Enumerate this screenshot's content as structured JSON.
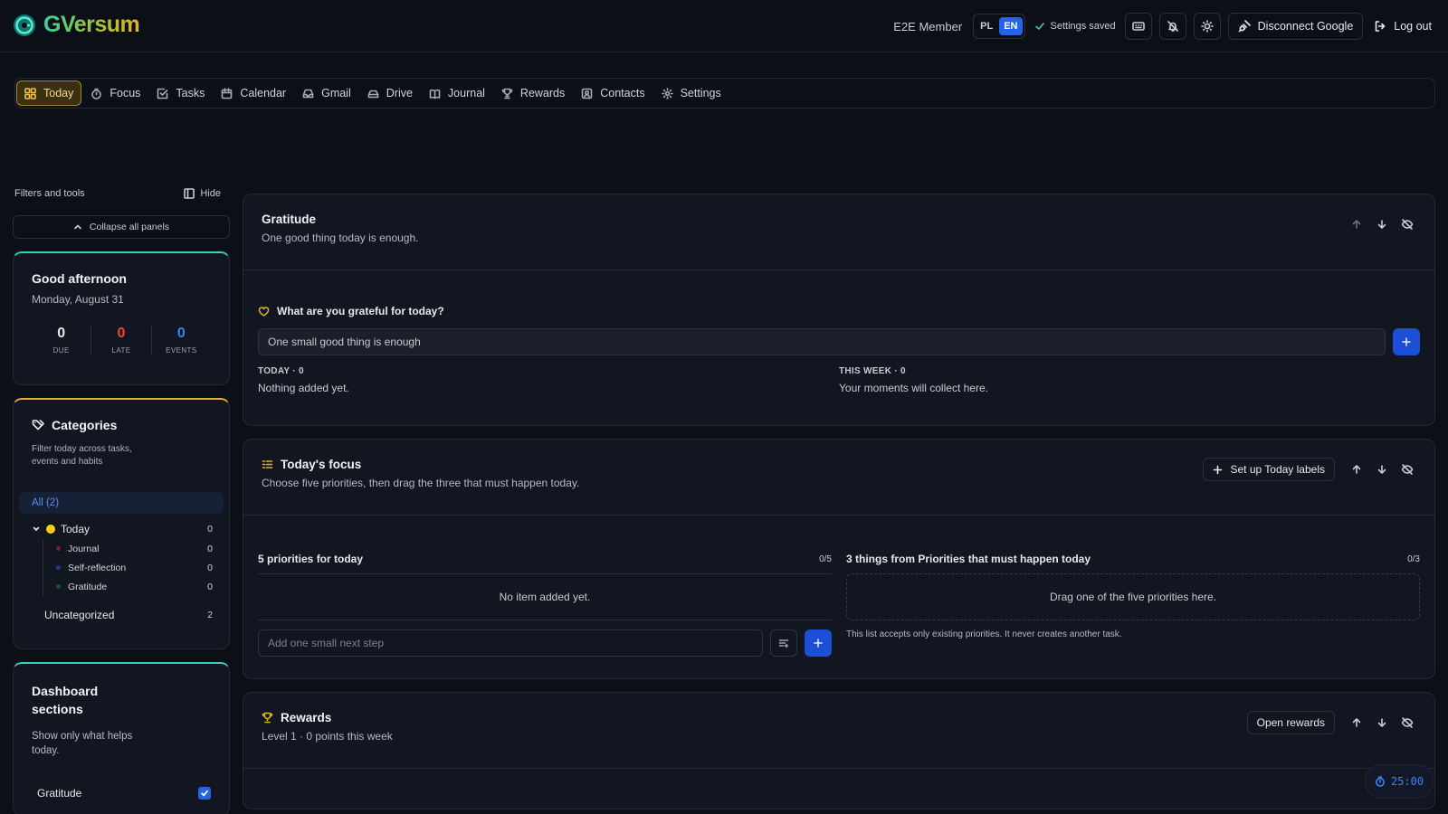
{
  "app": {
    "name": "GVersum"
  },
  "header": {
    "member_label": "E2E Member",
    "lang_options": [
      "PL",
      "EN"
    ],
    "lang_active": "EN",
    "saved_status": "Settings saved",
    "disconnect_label": "Disconnect Google",
    "logout_label": "Log out"
  },
  "nav": {
    "items": [
      {
        "label": "Today",
        "icon": "grid-icon",
        "active": true
      },
      {
        "label": "Focus",
        "icon": "timer-icon"
      },
      {
        "label": "Tasks",
        "icon": "checkbox-icon"
      },
      {
        "label": "Calendar",
        "icon": "calendar-icon"
      },
      {
        "label": "Gmail",
        "icon": "inbox-icon"
      },
      {
        "label": "Drive",
        "icon": "drive-icon"
      },
      {
        "label": "Journal",
        "icon": "book-icon"
      },
      {
        "label": "Rewards",
        "icon": "trophy-icon"
      },
      {
        "label": "Contacts",
        "icon": "contact-icon"
      },
      {
        "label": "Settings",
        "icon": "gear-icon"
      }
    ]
  },
  "sidebar": {
    "filters_label": "Filters and tools",
    "hide_label": "Hide",
    "collapse_label": "Collapse all panels",
    "greeting": {
      "title": "Good afternoon",
      "date": "Monday, August 31",
      "stats": [
        {
          "value": "0",
          "caption": "DUE",
          "color": "#e6e8ec"
        },
        {
          "value": "0",
          "caption": "LATE",
          "color": "#ef4444"
        },
        {
          "value": "0",
          "caption": "EVENTS",
          "color": "#3b82f6"
        }
      ]
    },
    "categories": {
      "title": "Categories",
      "description": "Filter today across tasks, events and habits",
      "all_label": "All (2)",
      "today": {
        "label": "Today",
        "count": "0"
      },
      "sub": [
        {
          "label": "Journal",
          "count": "0",
          "color": "#7f1d1d"
        },
        {
          "label": "Self-reflection",
          "count": "0",
          "color": "#1e3a8a"
        },
        {
          "label": "Gratitude",
          "count": "0",
          "color": "#14532d"
        }
      ],
      "uncategorized": {
        "label": "Uncategorized",
        "count": "2"
      }
    },
    "sections": {
      "title": "Dashboard sections",
      "description": "Show only what helps today.",
      "toggle_label": "Gratitude",
      "toggle_checked": true
    }
  },
  "gratitude": {
    "title": "Gratitude",
    "subtitle": "One good thing today is enough.",
    "question": "What are you grateful for today?",
    "input_value": "One small good thing is enough",
    "today_caption": "TODAY · 0",
    "today_text": "Nothing added yet.",
    "week_caption": "THIS WEEK · 0",
    "week_text": "Your moments will collect here."
  },
  "focus": {
    "title": "Today's focus",
    "subtitle": "Choose five priorities, then drag the three that must happen today.",
    "setup_label": "Set up Today labels",
    "priorities_title": "5 priorities for today",
    "priorities_count": "0/5",
    "priorities_empty": "No item added yet.",
    "step_placeholder": "Add one small next step",
    "must_title": "3 things from Priorities that must happen today",
    "must_count": "0/3",
    "must_drop": "Drag one of the five priorities here.",
    "must_note": "This list accepts only existing priorities. It never creates another task."
  },
  "rewards": {
    "title": "Rewards",
    "subtitle": "Level 1 · 0 points this week",
    "open_label": "Open rewards"
  },
  "timer": {
    "value": "25:00"
  }
}
